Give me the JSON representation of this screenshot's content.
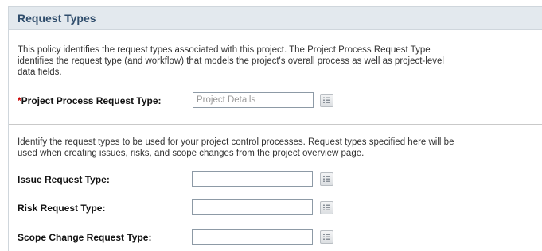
{
  "section": {
    "title": "Request Types"
  },
  "policy": {
    "description_lines": [
      "This policy identifies the request types associated with this project. The Project Process Request Type",
      "identifies the request type (and workflow) that models the project's overall process as well as project-level",
      "data fields."
    ]
  },
  "project_process": {
    "required_marker": "*",
    "label": "Project Process Request Type:",
    "value": "Project Details"
  },
  "control": {
    "description_lines": [
      "Identify the request types to be used for your project control processes. Request types specified here will be",
      "used when creating issues, risks, and scope changes from the project overview page."
    ],
    "fields": [
      {
        "label": "Issue Request Type:",
        "value": ""
      },
      {
        "label": "Risk Request Type:",
        "value": ""
      },
      {
        "label": "Scope Change Request Type:",
        "value": ""
      }
    ]
  },
  "icons": {
    "picker": "list-picker-icon"
  },
  "colors": {
    "header_bg": "#e3e9ee",
    "header_text": "#2f4d6c",
    "required": "#cc0000"
  }
}
